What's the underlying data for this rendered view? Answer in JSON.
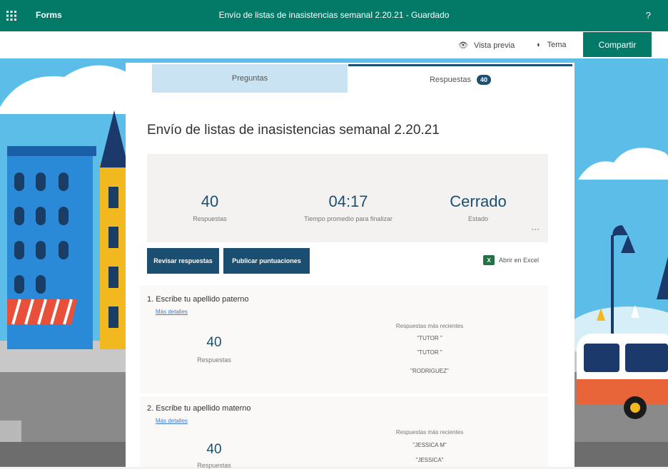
{
  "topbar": {
    "app_name": "Forms",
    "doc_title": "Envío de listas de inasistencias semanal 2.20.21 - Guardado",
    "help": "?"
  },
  "commandbar": {
    "preview": "Vista previa",
    "theme": "Tema",
    "share": "Compartir"
  },
  "tabs": [
    {
      "label": "Preguntas"
    },
    {
      "label": "Respuestas",
      "count": "40"
    }
  ],
  "form": {
    "title": "Envío de listas de inasistencias semanal 2.20.21"
  },
  "summary": {
    "responses": {
      "value": "40",
      "label": "Respuestas"
    },
    "avg_time": {
      "value": "04:17",
      "label": "Tiempo promedio para finalizar"
    },
    "status": {
      "value": "Cerrado",
      "label": "Estado"
    },
    "more": "···"
  },
  "actions": {
    "review": "Revisar respuestas",
    "publish": "Publicar puntuaciones",
    "excel": "Abrir en Excel"
  },
  "questions": [
    {
      "title": "1.  Escribe tu apellido paterno",
      "link": "Más detalles",
      "count": "40",
      "count_label": "Respuestas",
      "recent_title": "Respuestas más recientes",
      "recent": [
        "\"TUTOR \"",
        "\"TUTOR \"",
        "\"RODRIGUEZ\""
      ]
    },
    {
      "title": "2.  Escribe tu apellido materno",
      "link": "Más detalles",
      "count": "40",
      "count_label": "Respuestas",
      "recent_title": "Respuestas más recientes",
      "recent": [
        "\"JESSICA M\"",
        "\"JESSICA\""
      ]
    }
  ],
  "colors": {
    "brand": "#037a68",
    "accent": "#1b4f72",
    "sky": "#5dbde9"
  }
}
